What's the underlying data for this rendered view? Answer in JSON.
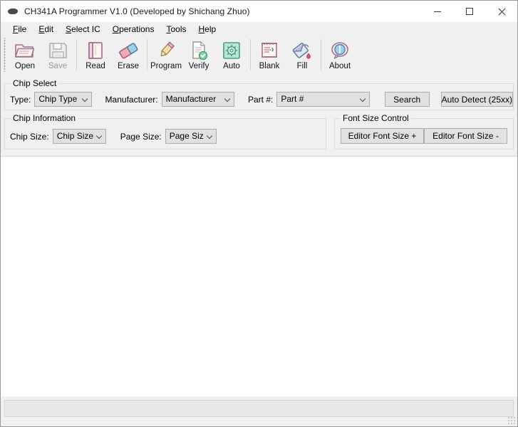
{
  "window": {
    "title": "CH341A Programmer V1.0 (Developed by Shichang Zhuo)",
    "icon": "chip-icon",
    "controls": {
      "minimize": "minimize-icon",
      "maximize": "maximize-icon",
      "close": "close-icon"
    }
  },
  "menu": {
    "items": [
      {
        "label": "File",
        "accel": "F"
      },
      {
        "label": "Edit",
        "accel": "E"
      },
      {
        "label": "Select IC",
        "accel": "S"
      },
      {
        "label": "Operations",
        "accel": "O"
      },
      {
        "label": "Tools",
        "accel": "T"
      },
      {
        "label": "Help",
        "accel": "H"
      }
    ]
  },
  "toolbar": {
    "buttons": [
      {
        "label": "Open",
        "icon": "open-folder-icon",
        "enabled": true
      },
      {
        "label": "Save",
        "icon": "floppy-disk-icon",
        "enabled": false
      },
      {
        "label": "Read",
        "icon": "book-icon",
        "enabled": true
      },
      {
        "label": "Erase",
        "icon": "eraser-icon",
        "enabled": true
      },
      {
        "label": "Program",
        "icon": "pencil-icon",
        "enabled": true
      },
      {
        "label": "Verify",
        "icon": "document-check-icon",
        "enabled": true
      },
      {
        "label": "Auto",
        "icon": "gear-chip-icon",
        "enabled": true
      },
      {
        "label": "Blank",
        "icon": "notepad-icon",
        "enabled": true
      },
      {
        "label": "Fill",
        "icon": "paint-bucket-icon",
        "enabled": true
      },
      {
        "label": "About",
        "icon": "info-bubble-icon",
        "enabled": true
      }
    ],
    "separators_after": [
      "Save",
      "Program",
      "Auto",
      "Fill"
    ]
  },
  "chip_select": {
    "title": "Chip Select",
    "type_label": "Type:",
    "type_value": "Chip Type",
    "manufacturer_label": "Manufacturer:",
    "manufacturer_value": "Manufacturer",
    "part_label": "Part #:",
    "part_value": "Part #",
    "search_button": "Search",
    "auto_detect_button": "Auto Detect (25xx)"
  },
  "chip_information": {
    "title": "Chip Information",
    "chip_size_label": "Chip Size:",
    "chip_size_value": "Chip Size",
    "page_size_label": "Page Size:",
    "page_size_value": "Page Size"
  },
  "font_size_control": {
    "title": "Font Size Control",
    "increase_button": "Editor Font Size +",
    "decrease_button": "Editor Font Size -"
  },
  "editor": {
    "content": ""
  },
  "status_bar": {
    "message": ""
  },
  "colors": {
    "window_chrome": "#f0f0f0",
    "title_bar": "#ffffff",
    "editor_background": "#ffffff",
    "groupbox_border": "#dcdcdc",
    "control_face": "#e1e1e1",
    "control_border": "#acacac",
    "disabled_text": "#9a9a9a",
    "close_hover": "#e81123"
  }
}
